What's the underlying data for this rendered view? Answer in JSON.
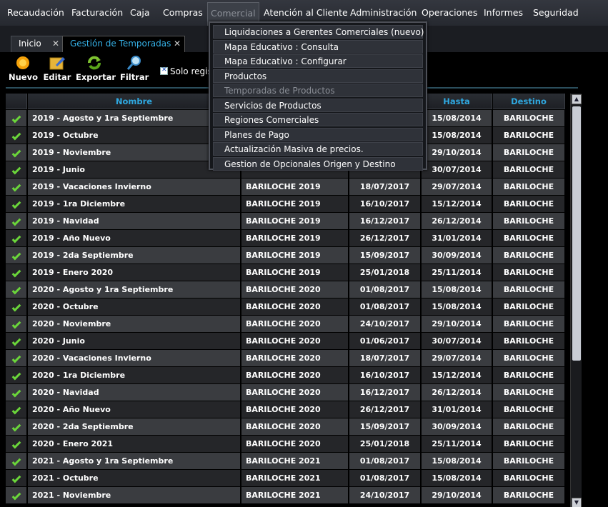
{
  "menubar": {
    "items": [
      {
        "label": "Recaudación",
        "active": false
      },
      {
        "label": "Facturación",
        "active": false
      },
      {
        "label": "Caja",
        "active": false
      },
      {
        "label": "Compras",
        "active": false
      },
      {
        "label": "Comercial",
        "active": true
      },
      {
        "label": "Atención al Cliente",
        "active": false
      },
      {
        "label": "Administración",
        "active": false
      },
      {
        "label": "Operaciones",
        "active": false
      },
      {
        "label": "Informes",
        "active": false
      },
      {
        "label": "Seguridad",
        "active": false
      }
    ]
  },
  "tabs": [
    {
      "label": "Inicio",
      "close": "✕"
    },
    {
      "label": "Gestión de Temporadas",
      "close": "✕"
    }
  ],
  "toolbar": {
    "nuevo": "Nuevo",
    "editar": "Editar",
    "exportar": "Exportar",
    "filtrar": "Filtrar",
    "checkbox_label": "Solo regis",
    "checkbox_checked": true
  },
  "grid": {
    "columns": {
      "nombre": "Nombre",
      "hasta": "Hasta",
      "destino": "Destino"
    },
    "rows": [
      {
        "nombre": "2019 - Agosto y 1ra Septiembre",
        "producto": "",
        "desde": "",
        "hasta": "15/08/2014",
        "destino": "BARILOCHE"
      },
      {
        "nombre": "2019 - Octubre",
        "producto": "",
        "desde": "",
        "hasta": "15/08/2014",
        "destino": "BARILOCHE"
      },
      {
        "nombre": "2019 - Noviembre",
        "producto": "",
        "desde": "",
        "hasta": "29/10/2014",
        "destino": "BARILOCHE"
      },
      {
        "nombre": "2019 - Junio",
        "producto": "",
        "desde": "",
        "hasta": "30/07/2014",
        "destino": "BARILOCHE"
      },
      {
        "nombre": "2019 - Vacaciones Invierno",
        "producto": "BARILOCHE 2019",
        "desde": "18/07/2017",
        "hasta": "29/07/2014",
        "destino": "BARILOCHE"
      },
      {
        "nombre": "2019 - 1ra Diciembre",
        "producto": "BARILOCHE 2019",
        "desde": "16/10/2017",
        "hasta": "15/12/2014",
        "destino": "BARILOCHE"
      },
      {
        "nombre": "2019 - Navidad",
        "producto": "BARILOCHE 2019",
        "desde": "16/12/2017",
        "hasta": "26/12/2014",
        "destino": "BARILOCHE"
      },
      {
        "nombre": "2019 - Año Nuevo",
        "producto": "BARILOCHE 2019",
        "desde": "26/12/2017",
        "hasta": "31/01/2014",
        "destino": "BARILOCHE"
      },
      {
        "nombre": "2019 - 2da Septiembre",
        "producto": "BARILOCHE 2019",
        "desde": "15/09/2017",
        "hasta": "30/09/2014",
        "destino": "BARILOCHE"
      },
      {
        "nombre": "2019 - Enero 2020",
        "producto": "BARILOCHE 2019",
        "desde": "25/01/2018",
        "hasta": "25/11/2014",
        "destino": "BARILOCHE"
      },
      {
        "nombre": "2020 - Agosto y 1ra Septiembre",
        "producto": "BARILOCHE 2020",
        "desde": "01/08/2017",
        "hasta": "15/08/2014",
        "destino": "BARILOCHE"
      },
      {
        "nombre": "2020 - Octubre",
        "producto": "BARILOCHE 2020",
        "desde": "01/08/2017",
        "hasta": "15/08/2014",
        "destino": "BARILOCHE"
      },
      {
        "nombre": "2020 - Noviembre",
        "producto": "BARILOCHE 2020",
        "desde": "24/10/2017",
        "hasta": "29/10/2014",
        "destino": "BARILOCHE"
      },
      {
        "nombre": "2020 - Junio",
        "producto": "BARILOCHE 2020",
        "desde": "01/06/2017",
        "hasta": "30/07/2014",
        "destino": "BARILOCHE"
      },
      {
        "nombre": "2020 - Vacaciones Invierno",
        "producto": "BARILOCHE 2020",
        "desde": "18/07/2017",
        "hasta": "29/07/2014",
        "destino": "BARILOCHE"
      },
      {
        "nombre": "2020 - 1ra Diciembre",
        "producto": "BARILOCHE 2020",
        "desde": "16/10/2017",
        "hasta": "15/12/2014",
        "destino": "BARILOCHE"
      },
      {
        "nombre": "2020 - Navidad",
        "producto": "BARILOCHE 2020",
        "desde": "16/12/2017",
        "hasta": "26/12/2014",
        "destino": "BARILOCHE"
      },
      {
        "nombre": "2020 - Año Nuevo",
        "producto": "BARILOCHE 2020",
        "desde": "26/12/2017",
        "hasta": "31/01/2014",
        "destino": "BARILOCHE"
      },
      {
        "nombre": "2020 - 2da Septiembre",
        "producto": "BARILOCHE 2020",
        "desde": "15/09/2017",
        "hasta": "30/09/2014",
        "destino": "BARILOCHE"
      },
      {
        "nombre": "2020 - Enero 2021",
        "producto": "BARILOCHE 2020",
        "desde": "25/01/2018",
        "hasta": "25/11/2014",
        "destino": "BARILOCHE"
      },
      {
        "nombre": "2021 - Agosto y 1ra Septiembre",
        "producto": "BARILOCHE 2021",
        "desde": "01/08/2017",
        "hasta": "15/08/2014",
        "destino": "BARILOCHE"
      },
      {
        "nombre": "2021 - Octubre",
        "producto": "BARILOCHE 2021",
        "desde": "01/08/2017",
        "hasta": "15/08/2014",
        "destino": "BARILOCHE"
      },
      {
        "nombre": "2021 - Noviembre",
        "producto": "BARILOCHE 2021",
        "desde": "24/10/2017",
        "hasta": "29/10/2014",
        "destino": "BARILOCHE"
      }
    ]
  },
  "dropdown": {
    "items": [
      {
        "label": "Liquidaciones a Gerentes Comerciales (nuevo)",
        "disabled": false
      },
      {
        "label": "Mapa Educativo : Consulta",
        "disabled": false
      },
      {
        "label": "Mapa Educativo : Configurar",
        "disabled": false
      },
      {
        "label": "Productos",
        "disabled": false
      },
      {
        "label": "Temporadas de Productos",
        "disabled": true
      },
      {
        "label": "Servicios de Productos",
        "disabled": false
      },
      {
        "label": "Regiones Comerciales",
        "disabled": false
      },
      {
        "label": "Planes de Pago",
        "disabled": false
      },
      {
        "label": "Actualización Masiva de precios.",
        "disabled": false
      },
      {
        "label": "Gestion de Opcionales Origen y Destino",
        "disabled": false
      }
    ]
  },
  "colors": {
    "accent": "#35b0e6",
    "check": "#6bd63a"
  }
}
